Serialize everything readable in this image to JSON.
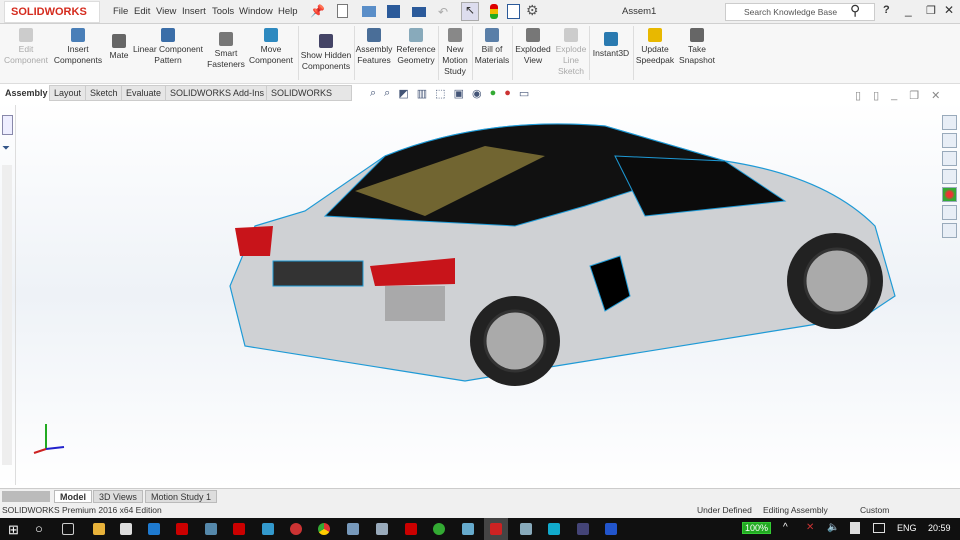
{
  "app": {
    "logo": "SOLIDWORKS",
    "title": "Assem1"
  },
  "menu": [
    "File",
    "Edit",
    "View",
    "Insert",
    "Tools",
    "Window",
    "Help"
  ],
  "search": {
    "placeholder": "Search Knowledge Base"
  },
  "ribbon": [
    {
      "label": "Edit Component",
      "disabled": true
    },
    {
      "label": "Insert Components"
    },
    {
      "label": "Mate"
    },
    {
      "label": "Linear Component Pattern"
    },
    {
      "label": "Smart Fasteners"
    },
    {
      "label": "Move Component"
    },
    {
      "label": "Show Hidden Components"
    },
    {
      "label": "Assembly Features"
    },
    {
      "label": "Reference Geometry"
    },
    {
      "label": "New Motion Study"
    },
    {
      "label": "Bill of Materials"
    },
    {
      "label": "Exploded View"
    },
    {
      "label": "Explode Line Sketch",
      "disabled": true
    },
    {
      "label": "Instant3D"
    },
    {
      "label": "Update Speedpak"
    },
    {
      "label": "Take Snapshot"
    }
  ],
  "tabs": [
    "Assembly",
    "Layout",
    "Sketch",
    "Evaluate",
    "SOLIDWORKS Add-Ins",
    "SOLIDWORKS MBD"
  ],
  "bottom_tabs": [
    "Model",
    "3D Views",
    "Motion Study 1"
  ],
  "status": {
    "edition": "SOLIDWORKS Premium 2016 x64 Edition",
    "state": "Under Defined",
    "mode": "Editing Assembly",
    "units": "Custom"
  },
  "taskbar": {
    "battery": "100%",
    "lang": "ENG",
    "time": "20:59"
  },
  "colors": {
    "accent": "#d52b1e",
    "edge": "#1e9ad6"
  }
}
